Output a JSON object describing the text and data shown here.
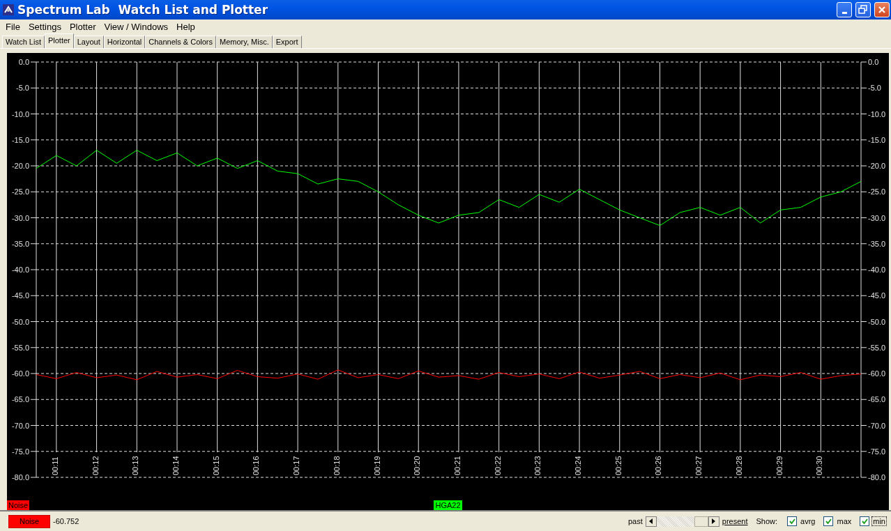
{
  "window": {
    "title": "Spectrum Lab  Watch List and Plotter"
  },
  "menu": [
    "File",
    "Settings",
    "Plotter",
    "View / Windows",
    "Help"
  ],
  "tabs": [
    {
      "label": "Watch List",
      "selected": false
    },
    {
      "label": "Plotter",
      "selected": true
    },
    {
      "label": "Layout",
      "selected": false
    },
    {
      "label": "Horizontal",
      "selected": false
    },
    {
      "label": "Channels & Colors",
      "selected": false
    },
    {
      "label": "Memory, Misc.",
      "selected": false
    },
    {
      "label": "Export",
      "selected": false
    }
  ],
  "plot": {
    "chart_data": {
      "type": "line",
      "grid": true,
      "xlim": [
        10.5,
        31
      ],
      "ylim": [
        -80,
        0
      ],
      "x": [
        10.5,
        11,
        11.5,
        12,
        12.5,
        13,
        13.5,
        14,
        14.5,
        15,
        15.5,
        16,
        16.5,
        17,
        17.5,
        18,
        18.5,
        19,
        19.5,
        20,
        20.5,
        21,
        21.5,
        22,
        22.5,
        23,
        23.5,
        24,
        24.5,
        25,
        25.5,
        26,
        26.5,
        27,
        27.5,
        28,
        28.5,
        29,
        29.5,
        30,
        30.5,
        31
      ],
      "series": [
        {
          "name": "Noise",
          "color": "#ff0000",
          "values": [
            -60.2,
            -61,
            -59.8,
            -60.8,
            -60.3,
            -61.2,
            -59.6,
            -60.7,
            -60.2,
            -61,
            -59.4,
            -60.6,
            -60.9,
            -60.1,
            -61.1,
            -59.3,
            -60.8,
            -60.2,
            -61,
            -59.5,
            -60.7,
            -60.4,
            -61.1,
            -59.8,
            -60.6,
            -60.1,
            -61,
            -59.7,
            -60.9,
            -60.3,
            -59.6,
            -61,
            -60.2,
            -60.8,
            -59.9,
            -61.2,
            -60.3,
            -60.6,
            -59.8,
            -61.1,
            -60.4,
            -60.1
          ]
        },
        {
          "name": "HGA22",
          "color": "#00ff00",
          "values": [
            -20.5,
            -18,
            -20,
            -17,
            -19.5,
            -17,
            -19,
            -17.5,
            -20,
            -18.5,
            -20.5,
            -19,
            -21,
            -21.5,
            -23.5,
            -22.5,
            -23,
            -25,
            -27.5,
            -29.5,
            -31,
            -29.5,
            -29,
            -26.5,
            -28,
            -25.5,
            -27,
            -24.5,
            -26.5,
            -28.5,
            -30,
            -31.5,
            -29,
            -28,
            -29.5,
            -28,
            -31,
            -28.5,
            -28,
            -26,
            -25,
            -23
          ]
        }
      ],
      "xticks": [
        {
          "value": 11,
          "label": "00:11"
        },
        {
          "value": 12,
          "label": "00:12"
        },
        {
          "value": 13,
          "label": "00:13"
        },
        {
          "value": 14,
          "label": "00:14"
        },
        {
          "value": 15,
          "label": "00:15"
        },
        {
          "value": 16,
          "label": "00:16"
        },
        {
          "value": 17,
          "label": "00:17"
        },
        {
          "value": 18,
          "label": "00:18"
        },
        {
          "value": 19,
          "label": "00:19"
        },
        {
          "value": 20,
          "label": "00:20"
        },
        {
          "value": 21,
          "label": "00:21"
        },
        {
          "value": 22,
          "label": "00:22"
        },
        {
          "value": 23,
          "label": "00:23"
        },
        {
          "value": 24,
          "label": "00:24"
        },
        {
          "value": 25,
          "label": "00:25"
        },
        {
          "value": 26,
          "label": "00:26"
        },
        {
          "value": 27,
          "label": "00:27"
        },
        {
          "value": 28,
          "label": "00:28"
        },
        {
          "value": 29,
          "label": "00:29"
        },
        {
          "value": 30,
          "label": "00:30"
        }
      ],
      "yticks": [
        {
          "value": 0,
          "label": "0.0"
        },
        {
          "value": -5,
          "label": "-5.0"
        },
        {
          "value": -10,
          "label": "-10.0"
        },
        {
          "value": -15,
          "label": "-15.0"
        },
        {
          "value": -20,
          "label": "-20.0"
        },
        {
          "value": -25,
          "label": "-25.0"
        },
        {
          "value": -30,
          "label": "-30.0"
        },
        {
          "value": -35,
          "label": "-35.0"
        },
        {
          "value": -40,
          "label": "-40.0"
        },
        {
          "value": -45,
          "label": "-45.0"
        },
        {
          "value": -50,
          "label": "-50.0"
        },
        {
          "value": -55,
          "label": "-55.0"
        },
        {
          "value": -60,
          "label": "-60.0"
        },
        {
          "value": -65,
          "label": "-65.0"
        },
        {
          "value": -70,
          "label": "-70.0"
        },
        {
          "value": -75,
          "label": "-75.0"
        },
        {
          "value": -80,
          "label": "-80.0"
        }
      ]
    }
  },
  "status_bar": {
    "channel_button": "Noise",
    "reading": "-60.752",
    "scroll": {
      "left_label": "past",
      "right_label": "present",
      "level": 1
    },
    "show_label": "Show:",
    "options": [
      {
        "label": "avrg",
        "checked": true
      },
      {
        "label": "max",
        "checked": true
      },
      {
        "label": "min",
        "checked": true
      }
    ]
  }
}
